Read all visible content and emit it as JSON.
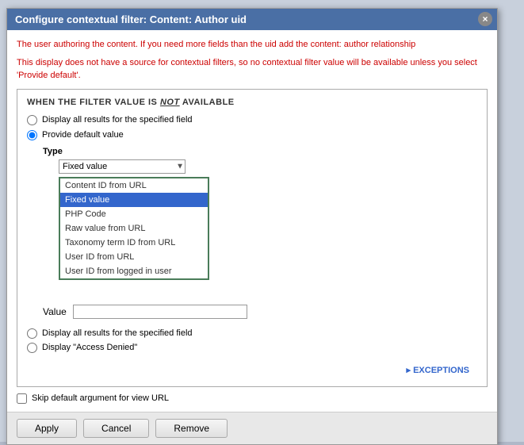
{
  "modal": {
    "title": "Configure contextual filter: Content: Author uid",
    "close_label": "×"
  },
  "info": {
    "line1": "The user authoring the content. If you need more fields than the uid add the content: author relationship",
    "line2": "This display does not have a source for contextual filters, so no contextual filter value will be available unless you select 'Provide default'."
  },
  "section": {
    "title_prefix": "WHEN THE FILTER VALUE IS ",
    "title_em": "NOT",
    "title_suffix": " AVAILABLE"
  },
  "radio_options": {
    "display_all": "Display all results for the specified field",
    "provide_default": "Provide default value"
  },
  "type": {
    "label": "Type",
    "selected": "Fixed value"
  },
  "dropdown_items": [
    {
      "label": "Content ID from URL",
      "selected": false
    },
    {
      "label": "Fixed value",
      "selected": true
    },
    {
      "label": "PHP Code",
      "selected": false
    },
    {
      "label": "Raw value from URL",
      "selected": false
    },
    {
      "label": "Taxonomy term ID from URL",
      "selected": false
    },
    {
      "label": "User ID from URL",
      "selected": false
    },
    {
      "label": "User ID from logged in user",
      "selected": false
    }
  ],
  "fallback": {
    "options": [
      "Display all results for the specified field",
      "Display \"Access Denied\""
    ]
  },
  "exceptions_label": "▸ EXCEPTIONS",
  "skip_checkbox_label": "Skip default argument for view URL",
  "buttons": {
    "apply": "Apply",
    "cancel": "Cancel",
    "remove": "Remove"
  }
}
